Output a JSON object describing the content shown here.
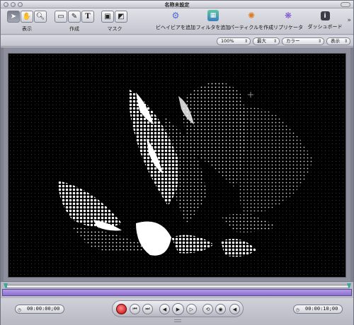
{
  "window": {
    "title": "名称未設定"
  },
  "toolbar": {
    "groups": [
      {
        "label": "表示",
        "buttons": [
          "select-tool",
          "pan-tool",
          "zoom-tool"
        ]
      },
      {
        "label": "作成",
        "buttons": [
          "rectangle-tool",
          "bezier-tool",
          "text-tool"
        ]
      },
      {
        "label": "マスク",
        "buttons": [
          "mask-rect-tool",
          "mask-bezier-tool"
        ]
      }
    ],
    "actions": [
      {
        "label": "ビヘイビアを追加",
        "icon": "gear-icon"
      },
      {
        "label": "フィルタを追加",
        "icon": "filter-icon"
      },
      {
        "label": "パーティクルを作成",
        "icon": "particle-icon"
      },
      {
        "label": "リプリケータ",
        "icon": "replicator-icon"
      },
      {
        "label": "ダッシュボード",
        "icon": "info-icon"
      }
    ]
  },
  "view_controls": {
    "zoom": "100%",
    "resolution": "最大",
    "channels": "カラー",
    "view": "表示"
  },
  "transport": {
    "start_timecode": "00:00:00;00",
    "end_timecode": "00:00:10;00"
  },
  "colors": {
    "accent_purple": "#8b6fd0",
    "record_red": "#c10000",
    "canvas_bg": "#000000"
  }
}
